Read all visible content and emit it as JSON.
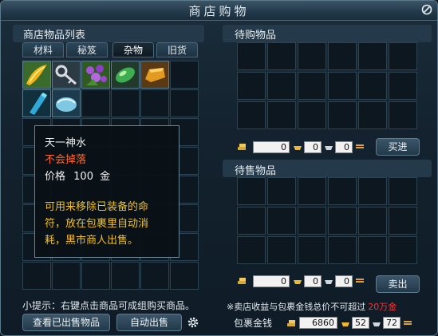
{
  "window": {
    "title": "商店购物"
  },
  "shop_list": {
    "title": "商店物品列表",
    "tabs": [
      "材料",
      "秘笈",
      "杂物",
      "旧货"
    ],
    "active_tab": 2
  },
  "tooltip": {
    "name": "天一神水",
    "drop": "不会掉落",
    "price_label": "价格",
    "price_value": "100",
    "price_unit": "金",
    "desc1": "可用来移除已装备的命",
    "desc2": "符，放在包裹里自动消",
    "desc3": "耗，黑市商人出售。"
  },
  "buy": {
    "title": "待购物品",
    "gold": "0",
    "silver": "0",
    "copper": "0",
    "button": "买进"
  },
  "sell": {
    "title": "待售物品",
    "gold": "0",
    "silver": "0",
    "copper": "0",
    "button": "卖出"
  },
  "footer": {
    "hint": "小提示：右键点击商品可成组购买商品。",
    "notice_prefix": "※卖店收益与包裹金钱总价不可超过",
    "notice_limit": "20万金",
    "view_sold_button": "查看已出售物品",
    "auto_sell_button": "自动出售",
    "wallet_label": "包裹金钱",
    "wallet_gold": "6860",
    "wallet_silver": "52",
    "wallet_copper": "72"
  },
  "colors": {
    "drop_text": "#ff6a2a",
    "tooltip_text": "#f0c020",
    "limit_text": "#ff3030"
  }
}
